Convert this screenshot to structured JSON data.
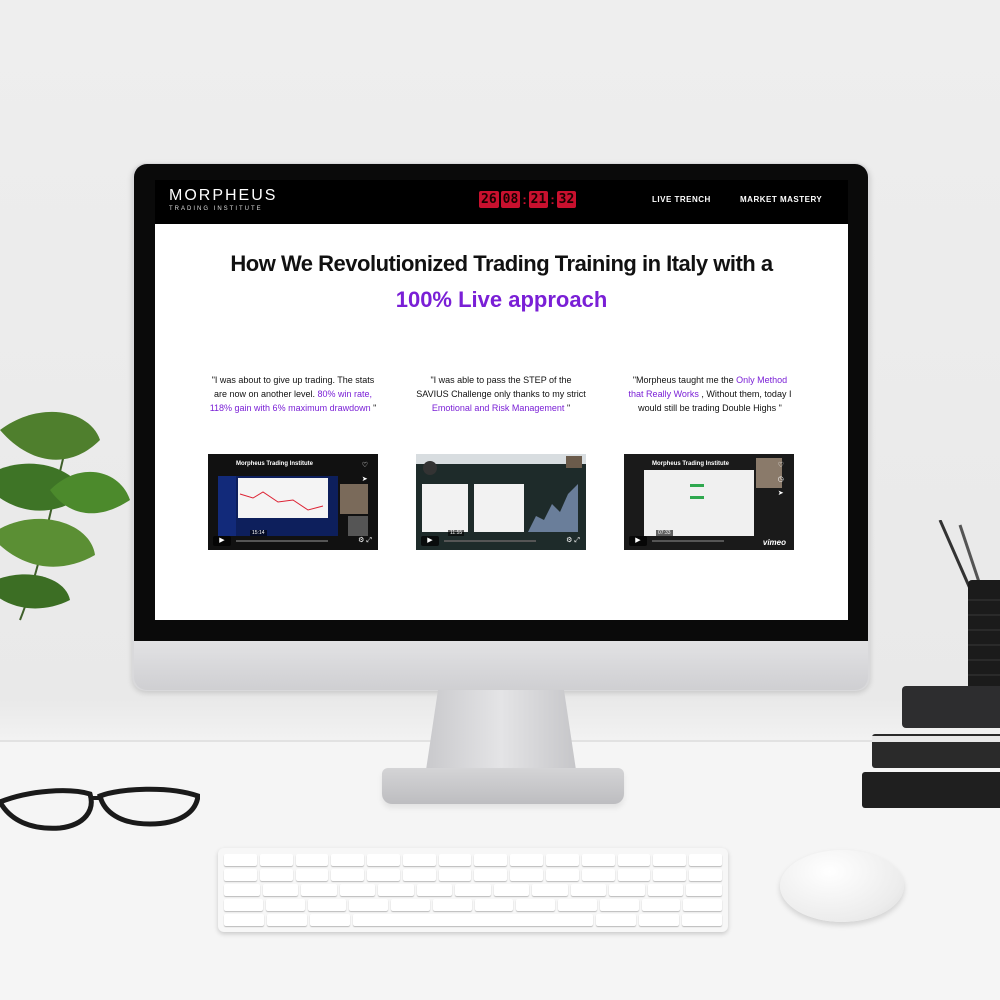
{
  "site": {
    "logo": {
      "name": "MORPHEUS",
      "tagline": "TRADING INSTITUTE"
    },
    "countdown": {
      "segments": [
        "26",
        "08",
        "21",
        "32"
      ]
    },
    "nav": [
      {
        "label": "LIVE TRENCH"
      },
      {
        "label": "MARKET MASTERY"
      }
    ]
  },
  "hero": {
    "line1": "How We Revolutionized Trading Training in Italy with a",
    "line2": "100% Live approach"
  },
  "testimonials": [
    {
      "parts": [
        {
          "text": "\"I was about to give up trading. The stats are now on another level. ",
          "highlight": false
        },
        {
          "text": "80% win rate, 118% gain with 6% maximum drawdown",
          "highlight": true
        },
        {
          "text": " \"",
          "highlight": false
        }
      ],
      "video": {
        "title": "Morpheus Trading Institute",
        "duration": "15:14"
      }
    },
    {
      "parts": [
        {
          "text": "\"I was able to pass the STEP of the SAVIUS Challenge only thanks to my strict ",
          "highlight": false
        },
        {
          "text": "Emotional and Risk Management",
          "highlight": true
        },
        {
          "text": " \"",
          "highlight": false
        }
      ],
      "video": {
        "title": "",
        "duration": "11:55"
      }
    },
    {
      "parts": [
        {
          "text": "\"Morpheus taught me the ",
          "highlight": false
        },
        {
          "text": "Only Method that Really Works",
          "highlight": true
        },
        {
          "text": " , Without them, today I would still be trading  Double Highs \"",
          "highlight": false
        }
      ],
      "video": {
        "title": "Morpheus Trading Institute",
        "duration": "07:33",
        "brand": "vimeo"
      }
    }
  ],
  "colors": {
    "accent": "#7a1fd6",
    "timer": "#c8102e",
    "topbar": "#000000"
  }
}
